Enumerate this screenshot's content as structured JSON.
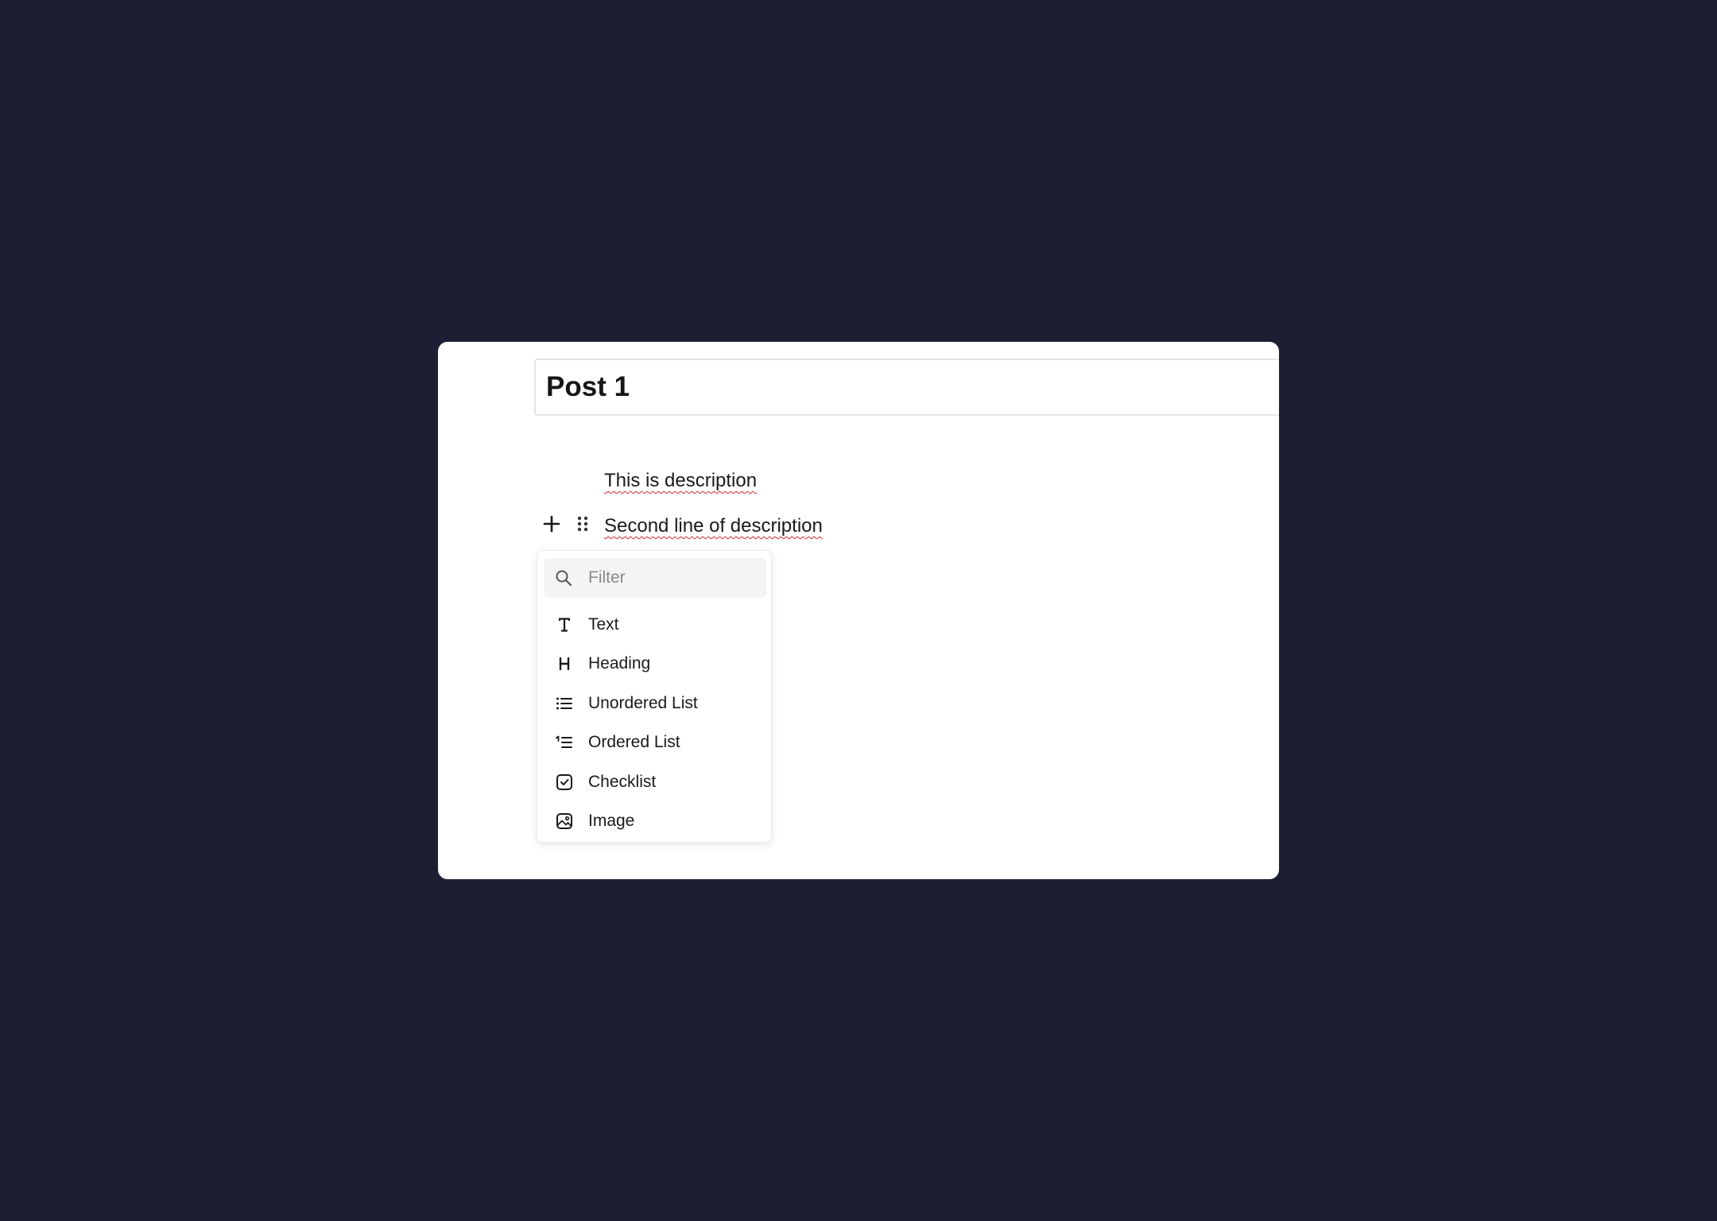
{
  "editor": {
    "title": "Post 1",
    "lines": [
      "This is description",
      "Second line of description"
    ]
  },
  "block_controls": {
    "add_icon": "plus-icon",
    "drag_icon": "drag-handle-icon"
  },
  "block_menu": {
    "filter": {
      "placeholder": "Filter",
      "value": "",
      "icon": "search-icon"
    },
    "items": [
      {
        "label": "Text",
        "icon": "text-icon"
      },
      {
        "label": "Heading",
        "icon": "heading-icon"
      },
      {
        "label": "Unordered List",
        "icon": "unordered-list-icon"
      },
      {
        "label": "Ordered List",
        "icon": "ordered-list-icon"
      },
      {
        "label": "Checklist",
        "icon": "checklist-icon"
      },
      {
        "label": "Image",
        "icon": "image-icon"
      }
    ]
  },
  "colors": {
    "background": "#1c1f34",
    "card": "#ffffff",
    "spellcheck_underline": "#d22b2b",
    "filter_background": "#f4f4f4"
  }
}
